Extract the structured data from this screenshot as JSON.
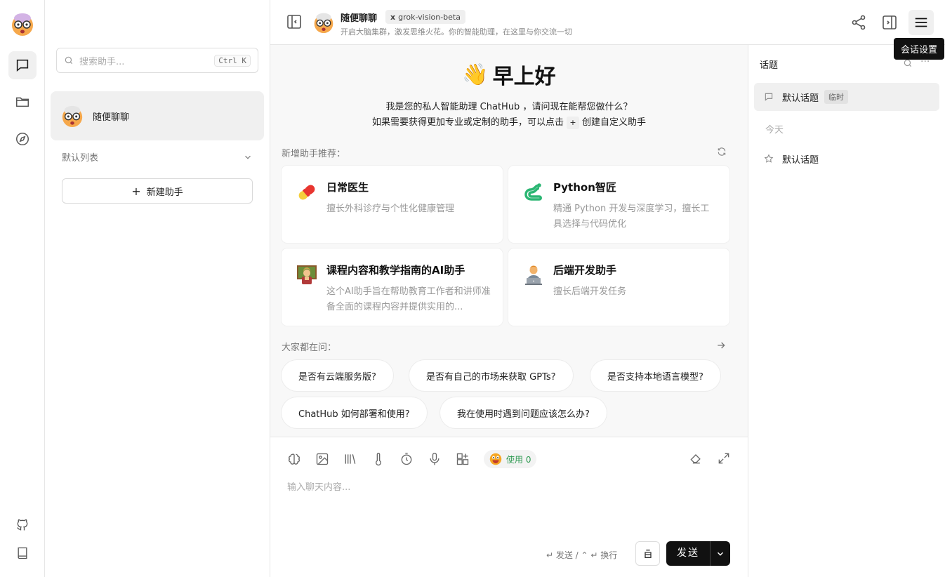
{
  "rail": {
    "avatar_emoji": "🤯",
    "icons": [
      "chat-icon",
      "folder-icon",
      "compass-icon",
      "github-icon",
      "book-icon"
    ]
  },
  "assistants": {
    "search_placeholder": "搜索助手...",
    "search_shortcut": "Ctrl K",
    "items": [
      {
        "name": "随便聊聊",
        "avatar": "🤯"
      }
    ],
    "group_label": "默认列表",
    "new_assistant": "新建助手"
  },
  "header": {
    "title": "随便聊聊",
    "model": "grok-vision-beta",
    "model_badge": "x",
    "description": "开启大脑集群，激发思维火花。你的智能助理，在这里与你交流一切",
    "tooltip": "会话设置"
  },
  "main": {
    "greeting_emoji": "👋",
    "greeting": "早上好",
    "intro_line1": "我是您的私人智能助理 ChatHub ，请问现在能帮您做什么？",
    "intro_line2_a": "如果需要获得更加专业或定制的助手，可以点击",
    "intro_line2_key": "+",
    "intro_line2_b": "创建自定义助手",
    "recommend_label": "新增助手推荐：",
    "cards": [
      {
        "title": "日常医生",
        "desc": "擅长外科诊疗与个性化健康管理",
        "icon": "pill-icon"
      },
      {
        "title": "Python智匠",
        "desc": "精通 Python 开发与深度学习，擅长工具选择与代码优化",
        "icon": "snake-icon"
      },
      {
        "title": "课程内容和教学指南的AI助手",
        "desc": "这个AI助手旨在帮助教育工作者和讲师准备全面的课程内容并提供实用的...",
        "icon": "teacher-icon"
      },
      {
        "title": "后端开发助手",
        "desc": "擅长后端开发任务",
        "icon": "developer-icon"
      }
    ],
    "faq_label": "大家都在问：",
    "faq": [
      "是否有云端服务版?",
      "是否有自己的市场来获取 GPTs?",
      "是否支持本地语言模型?",
      "ChatHub 如何部署和使用?",
      "我在使用时遇到问题应该怎么办?"
    ]
  },
  "input": {
    "usage_label": "使用 0",
    "placeholder": "输入聊天内容...",
    "hint": "↵ 发送 / ⌃ ↵ 换行",
    "send": "发送",
    "tools": [
      "brain-icon",
      "image-icon",
      "library-icon",
      "thermometer-icon",
      "timer-icon",
      "mic-icon",
      "plugin-icon"
    ]
  },
  "topics": {
    "title": "话题",
    "items": [
      {
        "label": "默认话题",
        "badge": "临时"
      }
    ],
    "day_label": "今天",
    "day_items": [
      {
        "label": "默认话题"
      }
    ]
  },
  "colors": {
    "accent": "#111111",
    "usage_green": "#2e9a51",
    "active_bg": "#f0f0f0"
  }
}
